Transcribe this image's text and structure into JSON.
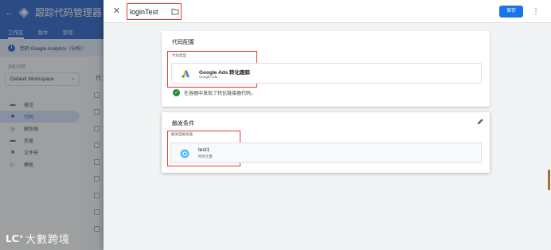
{
  "app": {
    "title": "跟踪代码管理器",
    "back_glyph": "←",
    "tabs": [
      {
        "label": "工作区",
        "active": true
      },
      {
        "label": "版本",
        "active": false
      },
      {
        "label": "管理",
        "active": false
      }
    ],
    "banner_text": "您的 Google Analytics（分析）：",
    "workspace_label": "当前工作区",
    "workspace_name": "Default Workspace",
    "workspace_chevron": "›",
    "nav": [
      {
        "label": "概览",
        "icon": "overview-icon",
        "glyph": "▬",
        "active": false
      },
      {
        "label": "代码",
        "icon": "tag-icon",
        "glyph": "■",
        "active": true
      },
      {
        "label": "触发器",
        "icon": "trigger-icon",
        "glyph": "◎",
        "active": false
      },
      {
        "label": "变量",
        "icon": "variable-icon",
        "glyph": "▬",
        "active": false
      },
      {
        "label": "文件夹",
        "icon": "folder-icon",
        "glyph": "■",
        "active": false
      },
      {
        "label": "模板",
        "icon": "template-icon",
        "glyph": "▷",
        "active": false
      }
    ],
    "list_header": "代"
  },
  "panel": {
    "close_glyph": "✕",
    "tag_name": "loginTest",
    "save_label": "保存",
    "more_glyph": "⋮",
    "tag_config": {
      "title": "代码配置",
      "field_label": "代码类型",
      "type_name": "Google Ads 转化跟踪",
      "type_sub": "Google Ads",
      "status_text": "在容器中发现了转化链接器代码。",
      "check_glyph": "✓"
    },
    "triggering": {
      "title": "触发条件",
      "field_label": "触发型触发器",
      "trigger_name": "test1",
      "trigger_sub": "所有元素"
    }
  },
  "watermark": {
    "logo": "ᒪᑕᐤ",
    "text": "大數跨境"
  },
  "colors": {
    "brand_blue": "#1a56c4",
    "primary_button": "#1a73e8",
    "highlight_red": "#e53935",
    "success_green": "#1e8e3e",
    "trigger_icon_blue": "#4fc3f7"
  }
}
